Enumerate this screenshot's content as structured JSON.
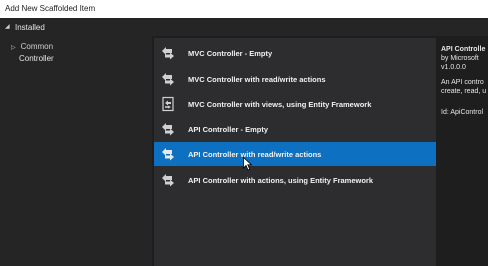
{
  "window": {
    "title": "Add New Scaffolded Item"
  },
  "installed": {
    "label": "Installed"
  },
  "tree": {
    "common_label": "Common",
    "controller_label": "Controller"
  },
  "templates": [
    {
      "label": "MVC Controller - Empty",
      "icon": "controller-icon"
    },
    {
      "label": "MVC Controller with read/write actions",
      "icon": "controller-icon"
    },
    {
      "label": "MVC Controller with views, using Entity Framework",
      "icon": "controller-views-icon"
    },
    {
      "label": "API Controller - Empty",
      "icon": "controller-icon"
    },
    {
      "label": "API Controller with read/write actions",
      "icon": "controller-icon",
      "selected": true
    },
    {
      "label": "API Controller with actions, using Entity Framework",
      "icon": "controller-icon"
    }
  ],
  "details": {
    "title": "API Controlle",
    "by": "by Microsoft",
    "version": "v1.0.0.0",
    "description_line1": "An API contro",
    "description_line2": "create, read, u",
    "id": "Id: ApiControl"
  },
  "colors": {
    "selection": "#0e70c0",
    "background": "#1e1e1e",
    "panel": "#2d2d30"
  }
}
